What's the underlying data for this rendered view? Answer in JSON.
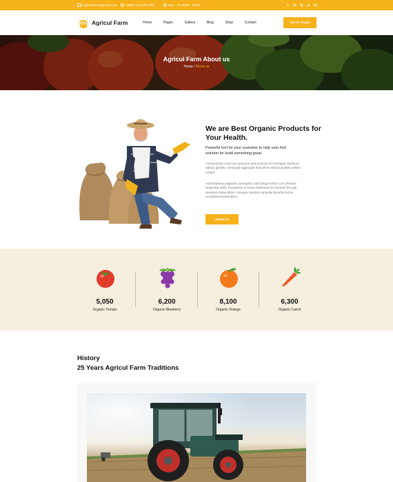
{
  "topbar": {
    "email": "AgriculFarm@gmail.com",
    "phone": "+88(0) 123-745-4783",
    "hours": "Mon - Fri 09:00 - 18:00",
    "socials": [
      "t",
      "in",
      "ig",
      "p",
      "in"
    ]
  },
  "nav": {
    "logo": "Agricul Farm",
    "menu": [
      "Home",
      "Pages",
      "Gallery",
      "Blog",
      "Shop",
      "Contact"
    ],
    "cta": "Get in Touch"
  },
  "hero": {
    "title": "Agricul Farm About us",
    "crumb_home": "Home",
    "crumb_sep": " / ",
    "crumb_current": "About us"
  },
  "about": {
    "title": "We are Best Organic Products for Your Health.",
    "lead": "Powerful tool for your customer to help user find solution for build something great.",
    "p1": "Conveniently customize proactive web services for leveraged interfaces without globally continually aggregate frictionless without globally wellies richard.",
    "p2": "Authoritatively plagiarize synergistic total linkage before cost effective leadership skills. Proactively innovate distributed be practices through seamless deliverables. Uniquely maximize granular benefits before exceptional deliverables.",
    "button": "About Us"
  },
  "stats": [
    {
      "icon": "tomato-icon",
      "value": "5,050",
      "label": "Organic Tomato"
    },
    {
      "icon": "grapes-icon",
      "value": "6,200",
      "label": "Organic Blueberry"
    },
    {
      "icon": "orange-icon",
      "value": "8,100",
      "label": "Organic Orange"
    },
    {
      "icon": "carrot-icon",
      "value": "6,300",
      "label": "Organic Carrot"
    }
  ],
  "history": {
    "eyebrow": "History",
    "title": "25 Years Agricul Farm Traditions"
  },
  "colors": {
    "accent": "#f6b21a",
    "stats_bg": "#f6eedf"
  }
}
